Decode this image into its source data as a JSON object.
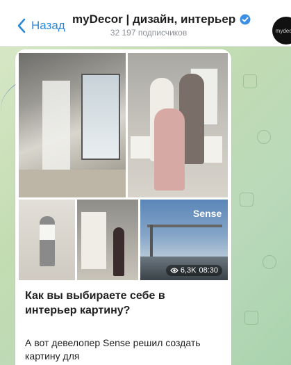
{
  "header": {
    "back_label": "Назад",
    "channel_name": "myDecor | дизайн, интерьер",
    "subscribers": "32 197 подписчиков",
    "avatar_text": "mydecor"
  },
  "post": {
    "video_views": "6,3K",
    "video_duration": "08:30",
    "photo_overlay_text": "Sense",
    "title": "Как вы выбираете себе в интерьер картину?",
    "body": "А вот девелопер Sense решил создать картину для"
  },
  "colors": {
    "accent": "#2a88d8",
    "verified": "#3d8fe3",
    "chat_bg": "#c3dcb2"
  },
  "icons": {
    "back": "chevron-left-icon",
    "verified": "verified-badge-icon",
    "views": "eye-icon"
  }
}
